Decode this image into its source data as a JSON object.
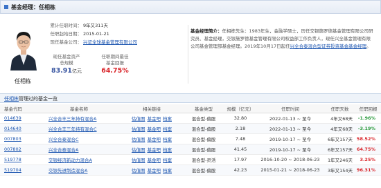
{
  "header": {
    "title": "基金经理：任相栋"
  },
  "manager": {
    "name": "任相栋",
    "info": [
      {
        "label": "累计任职时间：",
        "value": "9年又311天",
        "is_link": false
      },
      {
        "label": "任职起始日期：",
        "value": "2015-01-21",
        "is_link": false
      },
      {
        "label": "现任基金公司：",
        "value": "兴证全球基金管理有限公司",
        "is_link": true
      }
    ],
    "stats": [
      {
        "line1": "现任基金资产",
        "line2": "总规模",
        "value": "83.91",
        "unit": "亿元"
      },
      {
        "line1": "任职期间最佳",
        "line2": "基金回报",
        "value": "64.75%",
        "unit": ""
      }
    ],
    "bio": {
      "label": "基金经理简介：",
      "text": "任相栋先生：1983年生，金融学硕士，历任交银施罗德基金管理有限公司研究员、基金经理，交银施罗德基金管理有限公司权益部工作负责人，现任兴全基金管理有限公司基金管理部基金经理。2019年10月17日起任",
      "highlight": "兴全合泰混合型证券投资基金基金经理",
      "tail": "。"
    }
  },
  "section": {
    "name": "任相栋",
    "suffix": "管理过的基金一览"
  },
  "colors": {
    "accent": "#3c73c8",
    "link": "#1d56b0",
    "positive": "#d9262b",
    "negative": "#2a9a3c"
  },
  "table": {
    "headers": [
      "基金代码",
      "基金名称",
      "相关链接",
      "基金类型",
      "规模（亿元）",
      "任职时间",
      "任职天数",
      "任职回报"
    ],
    "rows": [
      {
        "code": "014639",
        "name": "兴全合丰三年持有混合A",
        "links": [
          "估值图",
          "基金吧",
          "档案"
        ],
        "type": "混合型-偏股",
        "scale": "32.80",
        "period": "2022-01-13 ~ 至今",
        "duration": "4年又68天",
        "ret": "-1.96%",
        "sign": "neg"
      },
      {
        "code": "014640",
        "name": "兴全合丰三年持有混合C",
        "links": [
          "估值图",
          "基金吧",
          "档案"
        ],
        "type": "混合型-偏股",
        "scale": "2.18",
        "period": "2022-01-13 ~ 至今",
        "duration": "4年又68天",
        "ret": "-3.19%",
        "sign": "neg"
      },
      {
        "code": "007803",
        "name": "兴全合泰混合C",
        "links": [
          "估值图",
          "基金吧",
          "档案"
        ],
        "type": "混合型-偏股",
        "scale": "7.48",
        "period": "2019-10-17 ~ 至今",
        "duration": "6年又157天",
        "ret": "58.52%",
        "sign": "pos"
      },
      {
        "code": "007802",
        "name": "兴全合泰混合A",
        "links": [
          "估值图",
          "基金吧",
          "档案"
        ],
        "type": "混合型-偏股",
        "scale": "41.45",
        "period": "2019-10-17 ~ 至今",
        "duration": "6年又157天",
        "ret": "64.75%",
        "sign": "pos"
      },
      {
        "code": "519778",
        "name": "交银经济新动力混合A",
        "links": [
          "估值图",
          "基金吧",
          "档案"
        ],
        "type": "混合型-灵活",
        "scale": "17.97",
        "period": "2016-10-20 ~ 2018-06-23",
        "duration": "1年又246天",
        "ret": "3.25%",
        "sign": "pos"
      },
      {
        "code": "519704",
        "name": "交银先进制造混合A",
        "links": [
          "估值图",
          "基金吧",
          "档案"
        ],
        "type": "混合型-偏股",
        "scale": "42.23",
        "period": "2015-01-21 ~ 2018-06-23",
        "duration": "3年又154天",
        "ret": "96.31%",
        "sign": "pos"
      }
    ]
  }
}
